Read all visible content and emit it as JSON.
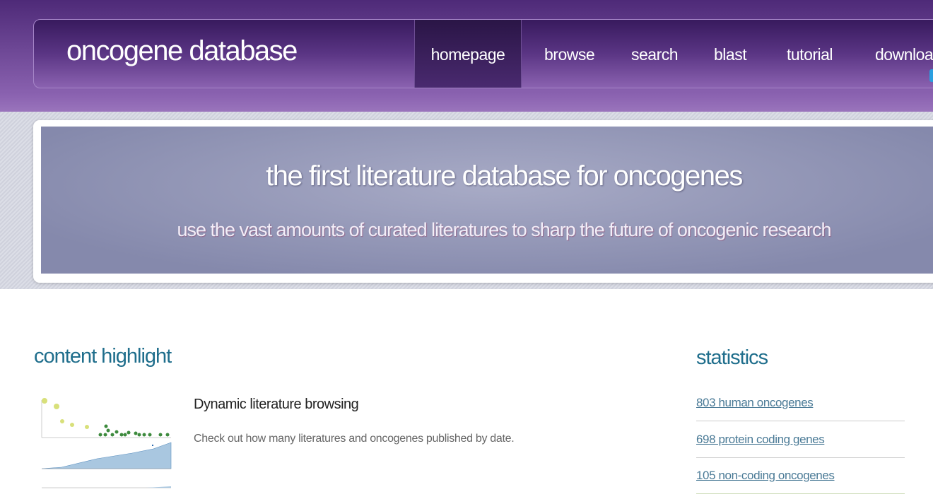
{
  "header": {
    "logo": "oncogene database",
    "nav": [
      {
        "label": "homepage",
        "active": true
      },
      {
        "label": "browse"
      },
      {
        "label": "search"
      },
      {
        "label": "blast"
      },
      {
        "label": "tutorial"
      },
      {
        "label": "download"
      }
    ]
  },
  "banner": {
    "title": "the first literature database for oncogenes",
    "subtitle": "use the vast amounts of curated literatures to sharp the future of oncogenic research"
  },
  "highlight": {
    "heading": "content highlight",
    "items": [
      {
        "title": "Dynamic literature browsing",
        "description": "Check out how many literatures and oncogenes published by date."
      }
    ]
  },
  "statistics": {
    "heading": "statistics",
    "items": [
      "803 human oncogenes",
      "698 protein coding genes",
      "105 non-coding oncogenes"
    ]
  },
  "colors": {
    "heading": "#1f6e8c",
    "nav_bg": "#5a3584",
    "link": "#4a7a96"
  }
}
